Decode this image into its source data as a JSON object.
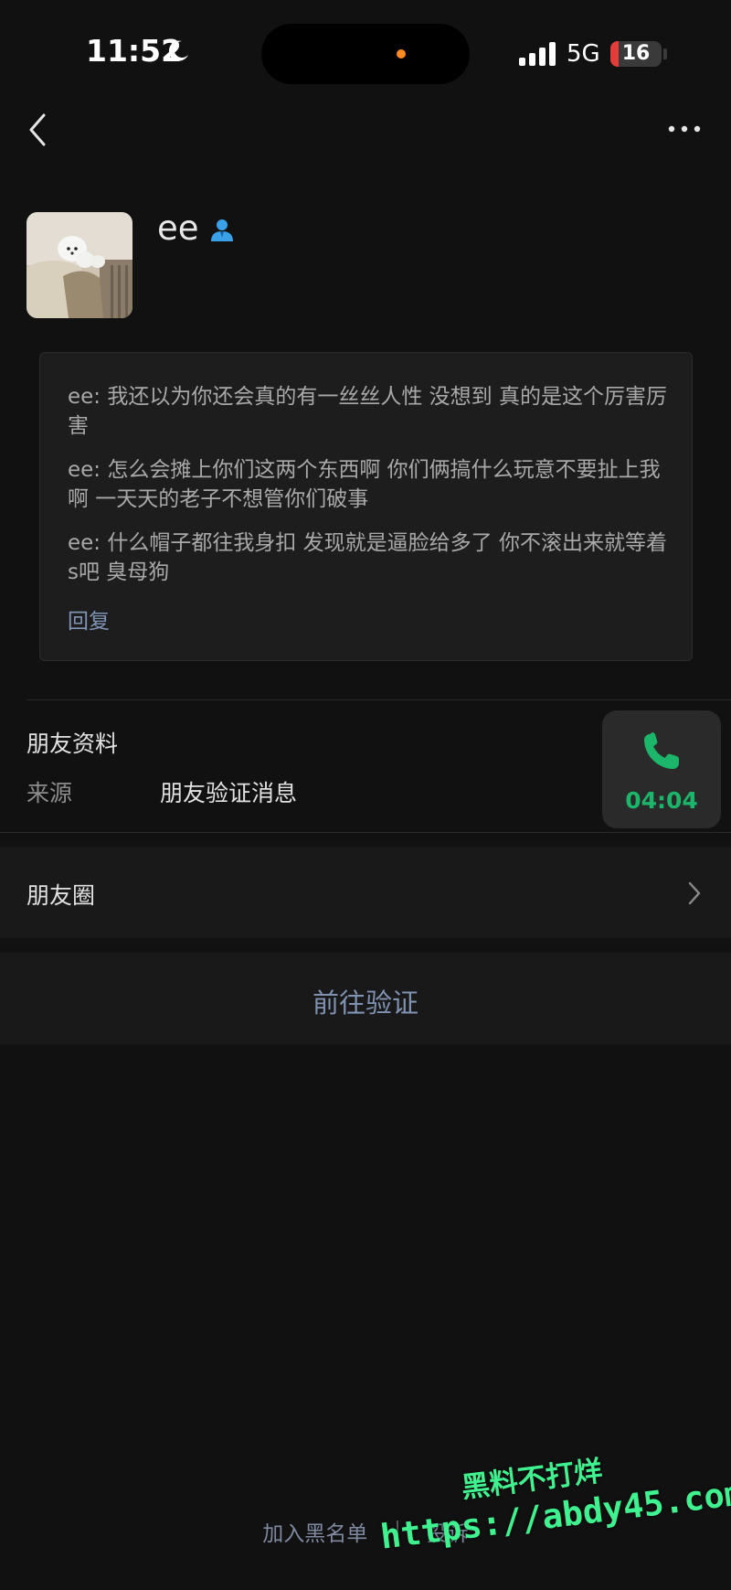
{
  "status_bar": {
    "time": "11:52",
    "network": "5G",
    "battery_level": "16",
    "battery_color": "#e43b3b"
  },
  "nav": {
    "back_icon": "chevron-left-icon",
    "more_icon": "more-dots-icon"
  },
  "profile": {
    "name": "ee",
    "badge_icon": "person-icon"
  },
  "greeting": {
    "messages": [
      "ee: 我还以为你还会真的有一丝丝人性 没想到 真的是这个厉害厉害",
      "ee: 怎么会摊上你们这两个东西啊 你们俩搞什么玩意不要扯上我啊 一天天的老子不想管你们破事",
      "ee: 什么帽子都往我身扣 发现就是逼脸给多了 你不滚出来就等着s吧 臭母狗"
    ],
    "reply_label": "回复"
  },
  "info": {
    "title": "朋友资料",
    "source_label": "来源",
    "source_value": "朋友验证消息"
  },
  "moments": {
    "label": "朋友圈"
  },
  "verify": {
    "label": "前往验证"
  },
  "call": {
    "duration": "04:04",
    "accent": "#1bb66a"
  },
  "footer": {
    "blacklist": "加入黑名单",
    "report": "投诉"
  },
  "watermark": {
    "line1": "黑料不打烊",
    "line2": "https://abdy45.com"
  }
}
